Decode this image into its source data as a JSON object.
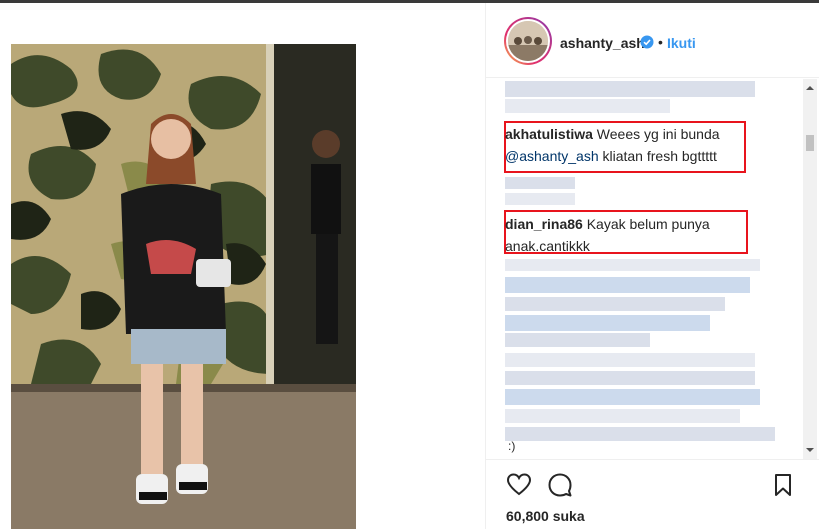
{
  "post": {
    "username": "ashanty_ash",
    "separator": "•",
    "follow_label": "Ikuti",
    "verified_icon": "verified-badge-icon"
  },
  "comments": [
    {
      "user": "akhatulistiwa",
      "text_before": " Weees yg ini bunda ",
      "mention": "@ashanty_ash",
      "text_after": " kliatan fresh bgttttt"
    },
    {
      "user": "dian_rina86",
      "text": " Kayak belum punya anak.cantikkk"
    }
  ],
  "trailing_text": ":)",
  "actions": {
    "like_icon": "heart-icon",
    "comment_icon": "comment-icon",
    "save_icon": "bookmark-icon",
    "likes_count": "60,800 suka"
  },
  "colors": {
    "accent": "#3897f0",
    "highlight": "#e8141d",
    "verified": "#3897f0"
  }
}
